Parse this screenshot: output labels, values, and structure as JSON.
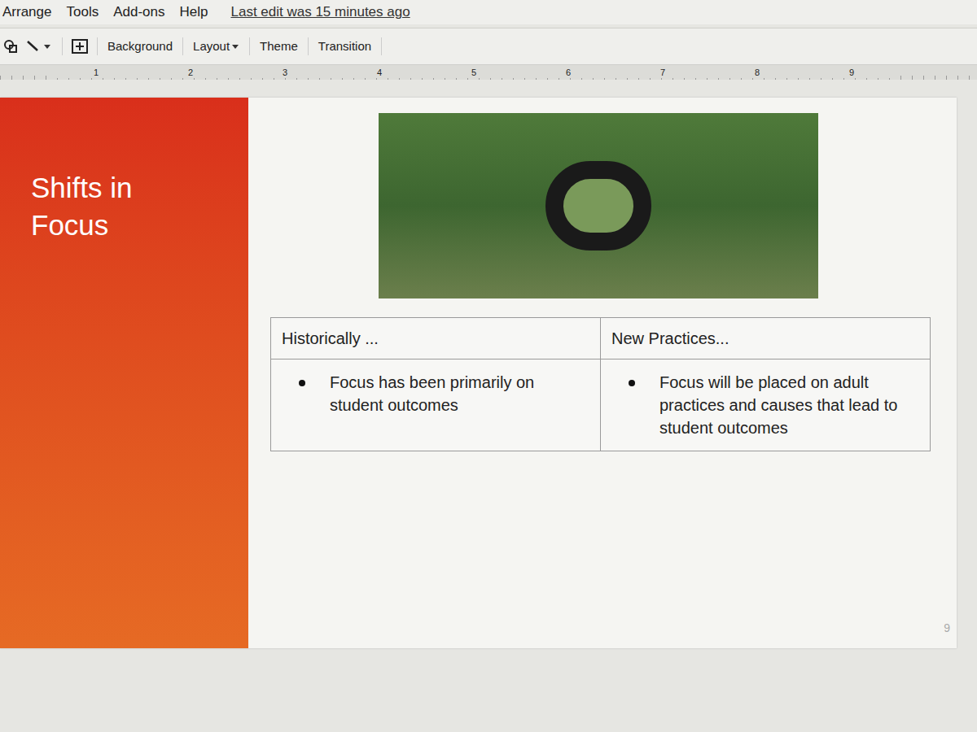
{
  "menu": {
    "items": [
      "Arrange",
      "Tools",
      "Add-ons",
      "Help"
    ],
    "last_edit": "Last edit was 15 minutes ago"
  },
  "toolbar": {
    "buttons": [
      {
        "label": "Background",
        "dropdown": false
      },
      {
        "label": "Layout",
        "dropdown": true
      },
      {
        "label": "Theme",
        "dropdown": false
      },
      {
        "label": "Transition",
        "dropdown": false
      }
    ]
  },
  "ruler": {
    "ticks": [
      "1",
      "2",
      "3",
      "4",
      "5",
      "6",
      "7",
      "8",
      "9"
    ]
  },
  "slide": {
    "title": "Shifts in Focus",
    "number": "9",
    "table": {
      "columns": [
        "Historically ...",
        "New Practices..."
      ],
      "rows": [
        [
          "Focus has been primarily on student outcomes",
          "Focus will be placed on adult practices and causes that lead to student outcomes"
        ]
      ]
    }
  }
}
